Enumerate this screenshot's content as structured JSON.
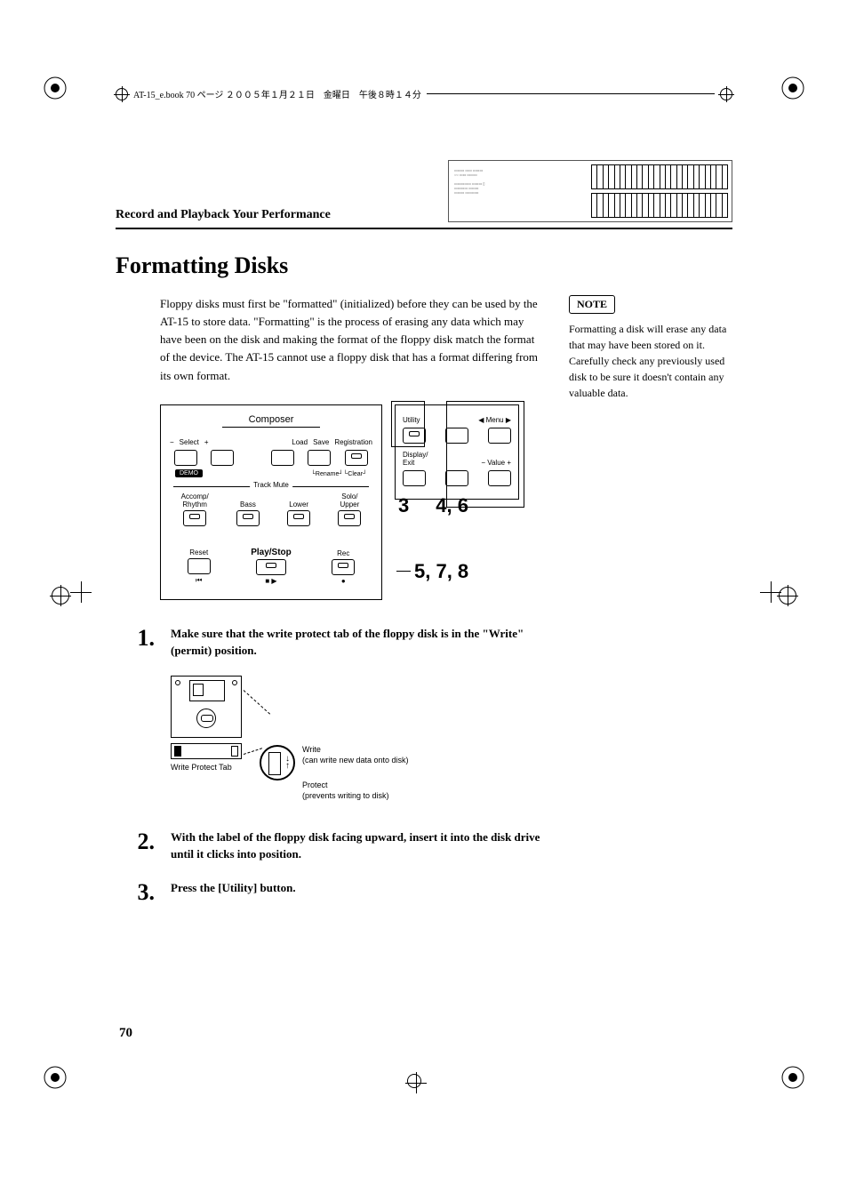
{
  "header_file_line": "AT-15_e.book 70 ページ ２００５年１月２１日　金曜日　午後８時１４分",
  "section_label": "Record and Playback Your Performance",
  "title": "Formatting Disks",
  "intro": "Floppy disks must first be \"formatted\" (initialized) before they can be used by the AT-15 to store data. \"Formatting\" is the process of erasing any data which may have been on the disk and making the format of the floppy disk match the format of the device. The AT-15 cannot use a floppy disk that has a format differing from its own format.",
  "note_label": "NOTE",
  "note_text": "Formatting a disk will erase any data that may have been stored on it. Carefully check any previously used disk to be sure it doesn't contain any valuable data.",
  "composer": {
    "title": "Composer",
    "select": "Select",
    "minus": "−",
    "plus": "+",
    "load": "Load",
    "save": "Save",
    "registration": "Registration",
    "demo": "DEMO",
    "rename": "Rename",
    "clear": "Clear",
    "track_mute": "Track Mute",
    "accomp": "Accomp/\nRhythm",
    "bass": "Bass",
    "lower": "Lower",
    "solo": "Solo/\nUpper",
    "reset": "Reset",
    "playstop": "Play/Stop",
    "rec": "Rec",
    "rew": "⏮",
    "stopplay": "■ ▶",
    "dot": "●"
  },
  "utility": {
    "utility": "Utility",
    "menu": "◀ Menu ▶",
    "display": "Display/\nExit",
    "value": "− Value +"
  },
  "callouts": {
    "c3": "3",
    "c46": "4, 6",
    "c578": "5, 7, 8"
  },
  "floppy": {
    "wpt": "Write Protect Tab",
    "write": "Write",
    "write_sub": "(can write new data onto disk)",
    "protect": "Protect",
    "protect_sub": "(prevents writing to disk)"
  },
  "steps": {
    "s1": "Make sure that the write protect tab of the floppy disk is in the \"Write\" (permit) position.",
    "s2": "With the label of the floppy disk facing upward, insert it into the disk drive until it clicks into position.",
    "s3": "Press the [Utility] button."
  },
  "page_number": "70"
}
